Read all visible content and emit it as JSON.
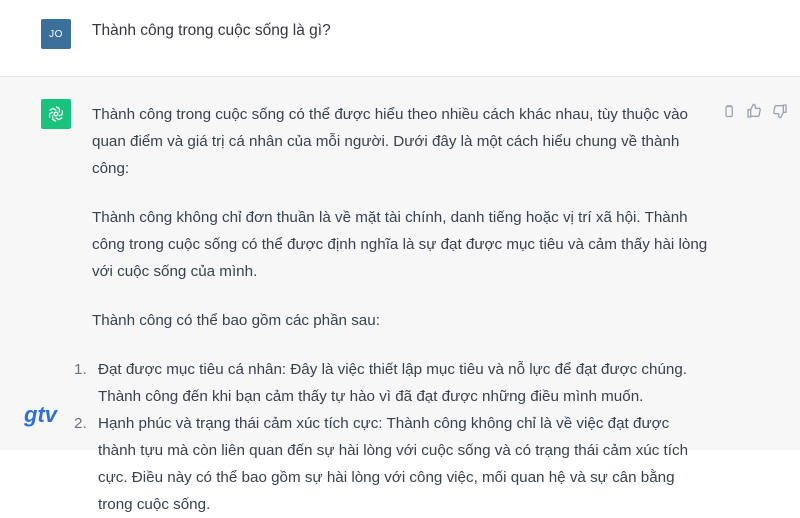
{
  "user": {
    "avatar_initials": "JO",
    "message": "Thành công trong cuộc sống là gì?"
  },
  "assistant": {
    "avatar_icon": "openai-logo-icon",
    "paragraphs": [
      "Thành công trong cuộc sống có thể được hiểu theo nhiều cách khác nhau, tùy thuộc vào quan điểm và giá trị cá nhân của mỗi người. Dưới đây là một cách hiểu chung về thành công:",
      "Thành công không chỉ đơn thuần là về mặt tài chính, danh tiếng hoặc vị trí xã hội. Thành công trong cuộc sống có thể được định nghĩa là sự đạt được mục tiêu và cảm thấy hài lòng với cuộc sống của mình.",
      "Thành công có thể bao gồm các phần sau:"
    ],
    "list": [
      {
        "num": "1.",
        "text": "Đạt được mục tiêu cá nhân: Đây là việc thiết lập mục tiêu và nỗ lực để đạt được chúng. Thành công đến khi bạn cảm thấy tự hào vì đã đạt được những điều mình muốn."
      },
      {
        "num": "2.",
        "text": "Hạnh phúc và trạng thái cảm xúc tích cực: Thành công không chỉ là về việc đạt được thành tựu mà còn liên quan đến sự hài lòng với cuộc sống và có trạng thái cảm xúc tích cực. Điều này có thể bao gồm sự hài lòng với công việc, mối quan hệ và sự cân bằng trong cuộc sống."
      }
    ],
    "actions": [
      "copy-icon",
      "thumbs-up-icon",
      "thumbs-down-icon"
    ]
  },
  "watermark": {
    "text": "gtv",
    "color": "#2f6fdc"
  },
  "colors": {
    "ai_avatar": "#19c37d",
    "user_avatar": "#3c6f99",
    "ai_bg": "#f7f7f8"
  }
}
